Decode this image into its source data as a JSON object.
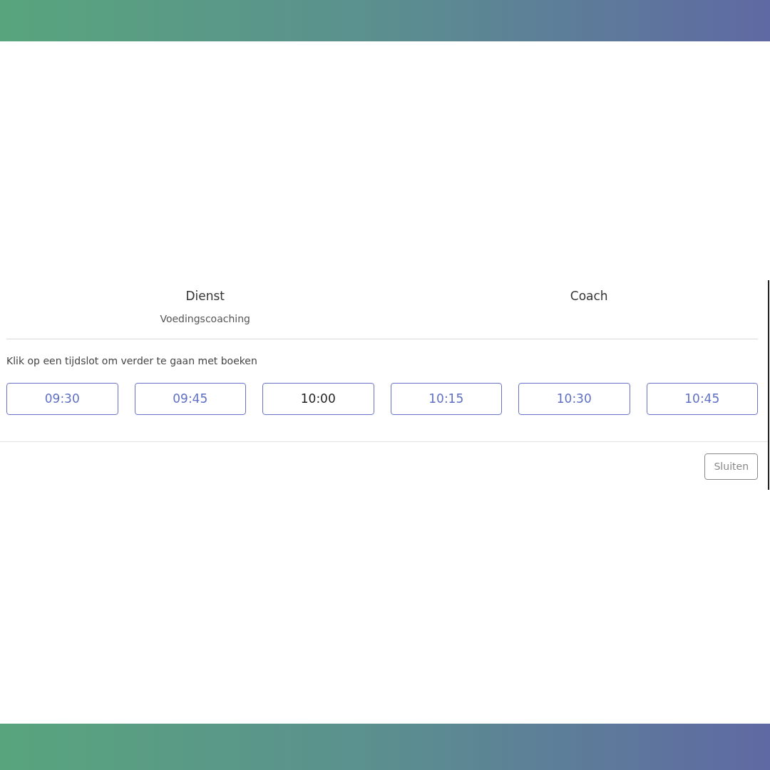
{
  "summary": [
    {
      "label": "Dienst",
      "value": "Voedingscoaching"
    },
    {
      "label": "Coach"
    }
  ],
  "instruction": "Klik op een tijdslot om verder te gaan met boeken",
  "time_slots": [
    {
      "label": "09:30",
      "hovered": false
    },
    {
      "label": "09:45",
      "hovered": false
    },
    {
      "label": "10:00",
      "hovered": true
    },
    {
      "label": "10:15",
      "hovered": false
    },
    {
      "label": "10:30",
      "hovered": false
    },
    {
      "label": "10:45",
      "hovered": false
    }
  ],
  "footer": {
    "close_button": "Sluiten"
  }
}
